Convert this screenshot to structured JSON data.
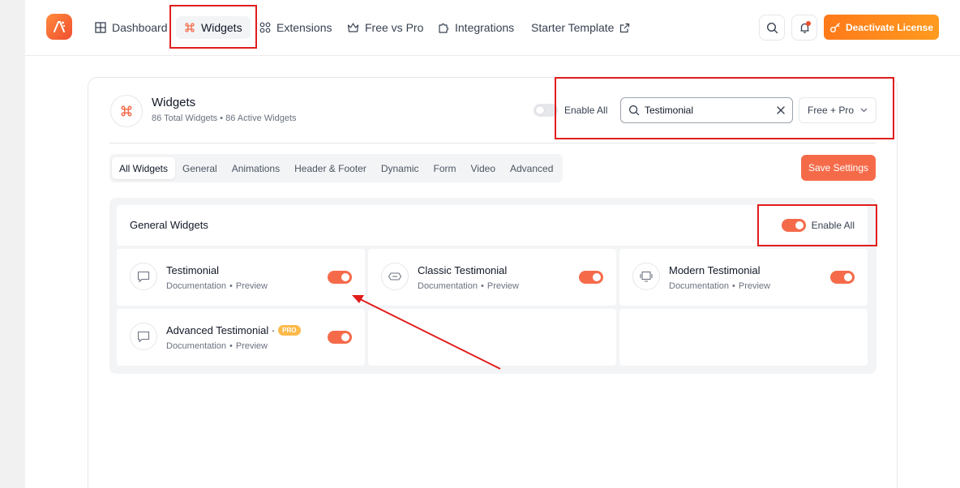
{
  "nav": {
    "items": [
      {
        "label": "Dashboard"
      },
      {
        "label": "Widgets"
      },
      {
        "label": "Extensions"
      },
      {
        "label": "Free vs Pro"
      },
      {
        "label": "Integrations"
      },
      {
        "label": "Starter Template"
      }
    ],
    "deactivate_label": "Deactivate License"
  },
  "header": {
    "title": "Widgets",
    "subtitle": "86 Total Widgets • 86 Active Widgets",
    "enable_all_label": "Enable All",
    "search_value": "Testimonial",
    "filter_label": "Free + Pro"
  },
  "tabs": [
    {
      "label": "All Widgets",
      "active": true
    },
    {
      "label": "General"
    },
    {
      "label": "Animations"
    },
    {
      "label": "Header & Footer"
    },
    {
      "label": "Dynamic"
    },
    {
      "label": "Form"
    },
    {
      "label": "Video"
    },
    {
      "label": "Advanced"
    }
  ],
  "save_label": "Save Settings",
  "section": {
    "title": "General Widgets",
    "enable_all_label": "Enable All",
    "widgets": [
      {
        "name": "Testimonial",
        "doc": "Documentation",
        "sep": "•",
        "preview": "Preview",
        "enabled": true
      },
      {
        "name": "Classic Testimonial",
        "doc": "Documentation",
        "sep": "•",
        "preview": "Preview",
        "enabled": true
      },
      {
        "name": "Modern Testimonial",
        "doc": "Documentation",
        "sep": "•",
        "preview": "Preview",
        "enabled": true
      },
      {
        "name": "Advanced Testimonial ·",
        "badge": "PRO",
        "doc": "Documentation",
        "sep": "•",
        "preview": "Preview",
        "enabled": true
      }
    ]
  },
  "colors": {
    "accent": "#f56b4a",
    "annotation": "#e11d1d",
    "license": "#ff8a1f"
  }
}
